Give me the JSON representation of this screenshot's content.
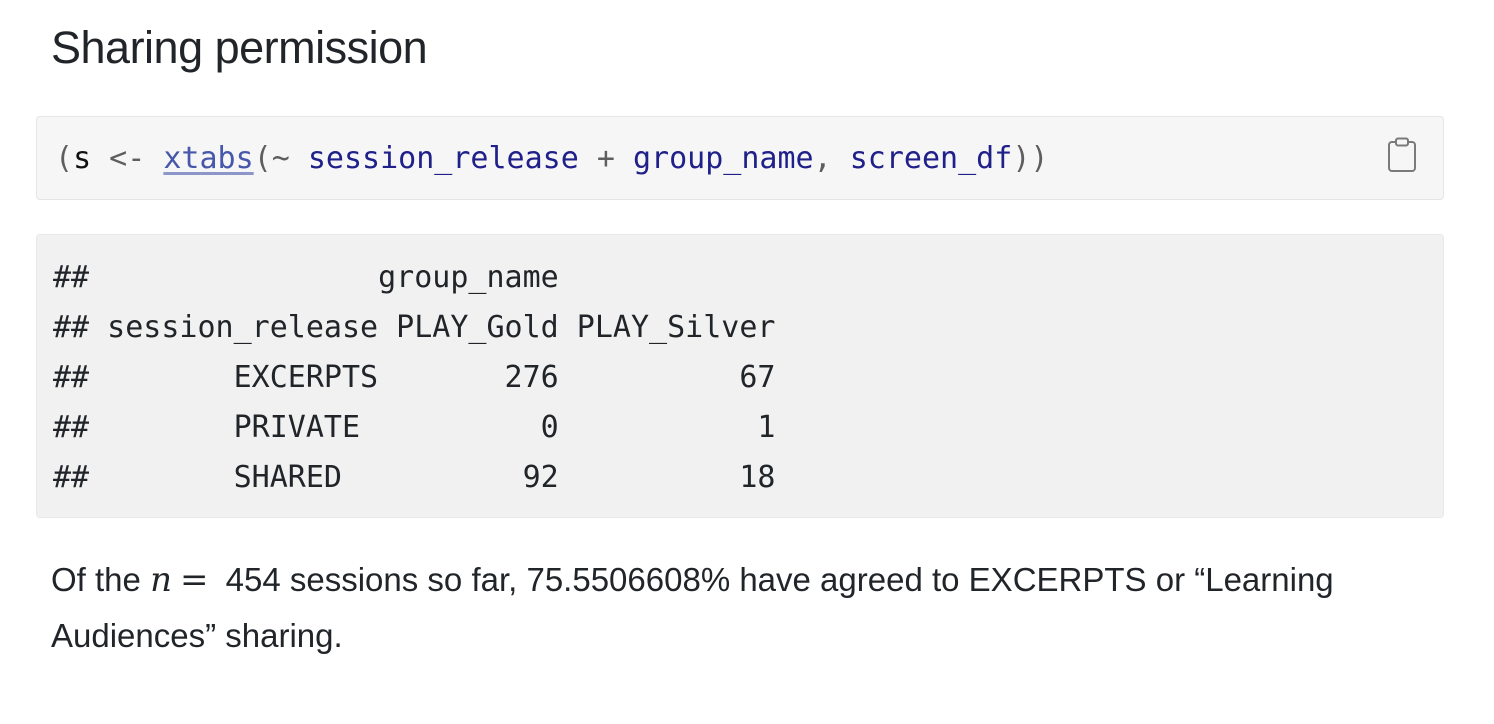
{
  "heading": "Sharing permission",
  "code": {
    "open_paren": "(",
    "var": "s",
    "assign": " <- ",
    "fn": "xtabs",
    "paren_open": "(",
    "tilde": "~ ",
    "arg1": "session_release",
    "plus": " + ",
    "arg2": "group_name",
    "comma": ", ",
    "arg3": "screen_df",
    "close": "))"
  },
  "copy_icon": "clipboard-icon",
  "output": {
    "header_line": "##                group_name",
    "col_header_line": "## session_release PLAY_Gold PLAY_Silver",
    "rows": [
      "##        EXCERPTS       276          67",
      "##        PRIVATE          0           1",
      "##        SHARED          92          18"
    ]
  },
  "summary": {
    "prefix": "Of the ",
    "math_var": "n",
    "math_eq": "=",
    "text_after": " 454 sessions so far, 75.5506608% have agreed to EXCERPTS or “Learning Audiences” sharing."
  },
  "colors": {
    "code_bg": "#f6f6f6",
    "output_bg": "#f1f1f1",
    "function_link": "#4758ab",
    "identifier": "#20208a"
  }
}
